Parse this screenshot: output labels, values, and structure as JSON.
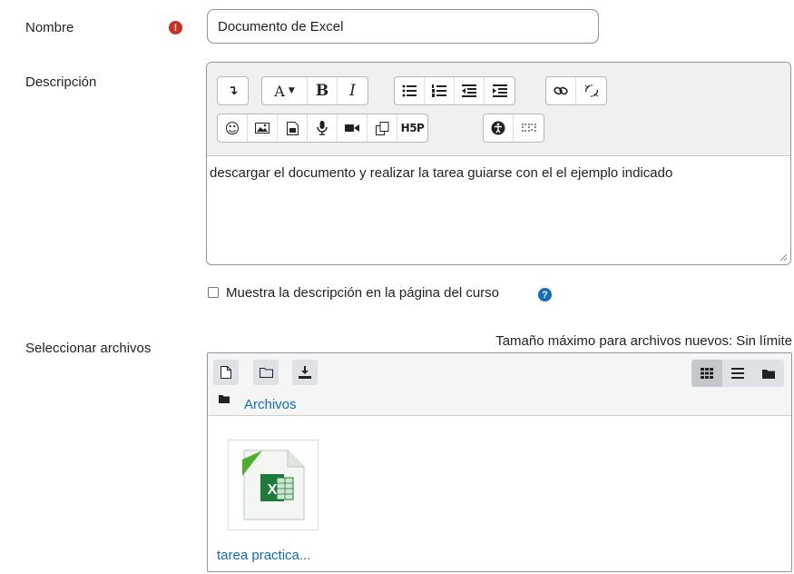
{
  "form": {
    "name_label": "Nombre",
    "name_value": "Documento de Excel",
    "description_label": "Descripción",
    "description_text": "descargar el documento y realizar la tarea guiarse con el el ejemplo indicado",
    "show_description_label": "Muestra la descripción en la página del curso",
    "show_description_checked": false,
    "files_label": "Seleccionar archivos",
    "max_size_text": "Tamaño máximo para archivos nuevos: Sin límite"
  },
  "editor_toolbar": {
    "row1": [
      {
        "icon": "collapse-icon",
        "glyph": "↴"
      },
      {
        "icon": "paragraph-style-icon",
        "glyph": "A ▾"
      },
      {
        "icon": "bold-icon",
        "glyph": "B"
      },
      {
        "icon": "italic-icon",
        "glyph": "I"
      },
      {
        "icon": "unordered-list-icon",
        "glyph": "☰"
      },
      {
        "icon": "ordered-list-icon",
        "glyph": "☰"
      },
      {
        "icon": "outdent-icon",
        "glyph": "⇤"
      },
      {
        "icon": "indent-icon",
        "glyph": "⇥"
      },
      {
        "icon": "link-icon",
        "glyph": "🔗"
      },
      {
        "icon": "unlink-icon",
        "glyph": "⛓"
      }
    ],
    "row2": [
      {
        "icon": "emoji-icon",
        "glyph": "☺"
      },
      {
        "icon": "image-icon",
        "glyph": "▣"
      },
      {
        "icon": "media-icon",
        "glyph": "▤"
      },
      {
        "icon": "microphone-icon",
        "glyph": "🎤"
      },
      {
        "icon": "video-icon",
        "glyph": "■"
      },
      {
        "icon": "manage-files-icon",
        "glyph": "⧉"
      },
      {
        "icon": "h5p-icon",
        "glyph": "H5P"
      },
      {
        "icon": "accessibility-checker-icon",
        "glyph": "◉"
      },
      {
        "icon": "screenreader-helper-icon",
        "glyph": "⠿"
      }
    ]
  },
  "filemanager": {
    "path_label": "Archivos",
    "file_name": "tarea practica...",
    "colors": {
      "accent": "#0f6cbf",
      "excel_green": "#1e7a3a"
    }
  },
  "colors": {
    "required": "#ca3120",
    "help": "#0f6cbf"
  }
}
